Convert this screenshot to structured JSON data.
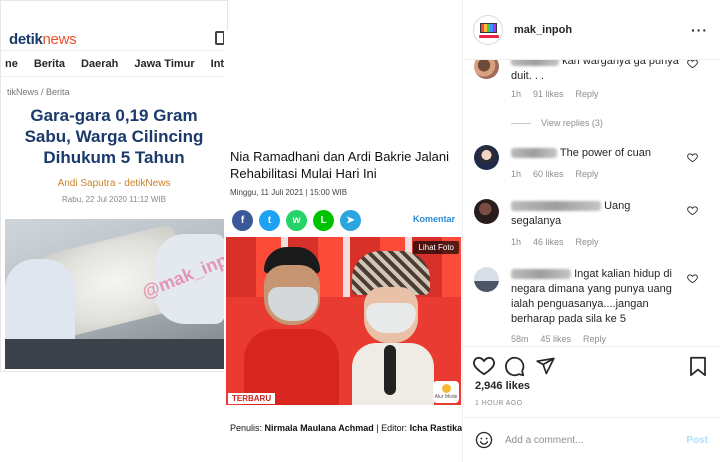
{
  "post": {
    "username": "mak_inpoh",
    "more_icon": "more-dots-icon",
    "likes": "2,946 likes",
    "time_ago": "1 HOUR AGO",
    "comment_placeholder": "Add a comment...",
    "post_label": "Post"
  },
  "media": {
    "article1": {
      "logo_bold": "detik",
      "logo_light": "news",
      "nav": [
        "ne",
        "Berita",
        "Daerah",
        "Jawa Timur",
        "Inter"
      ],
      "breadcrumb": "tikNews / Berita",
      "headline": "Gara-gara 0,19 Gram Sabu, Warga Cilincing Dihukum 5 Tahun",
      "author": "Andi Saputra - detikNews",
      "date": "Rabu, 22 Jul 2020 11:12 WIB",
      "watermark": "@mak_inpoh"
    },
    "article2": {
      "title": "Nia Ramadhani dan Ardi Bakrie Jalani Rehabilitasi Mulai Hari Ini",
      "date": "Minggu, 11 Juli 2021 | 15:00 WIB",
      "komentar": "Komentar",
      "lihat_foto": "Lihat Foto",
      "terbaru": "TERBARU",
      "badge": "Alur Mode",
      "credit_writer_label": "Penulis:",
      "credit_writer": "Nirmala Maulana Achmad",
      "credit_editor_label": "| Editor:",
      "credit_editor": "Icha Rastika",
      "share_icons": [
        "facebook-icon",
        "twitter-icon",
        "whatsapp-icon",
        "line-icon",
        "telegram-icon"
      ]
    }
  },
  "comments": [
    {
      "text": "kan warganya ga punya duit. . .",
      "time": "1h",
      "likes": "91 likes",
      "reply": "Reply"
    },
    {
      "view_replies": "View replies (3)"
    },
    {
      "text": "The power of cuan",
      "time": "1h",
      "likes": "60 likes",
      "reply": "Reply"
    },
    {
      "text": "Uang segalanya",
      "time": "1h",
      "likes": "46 likes",
      "reply": "Reply"
    },
    {
      "text": "Ingat kalian hidup di negara dimana yang punya uang ialah penguasanya....jangan berharap pada sila ke 5",
      "time": "58m",
      "likes": "45 likes",
      "reply": "Reply"
    }
  ],
  "colors": {
    "detik_blue": "#1a3a6b",
    "detik_orange": "#e8502c",
    "post_disabled": "#b2dffc",
    "meta_gray": "#8e8e8e"
  }
}
